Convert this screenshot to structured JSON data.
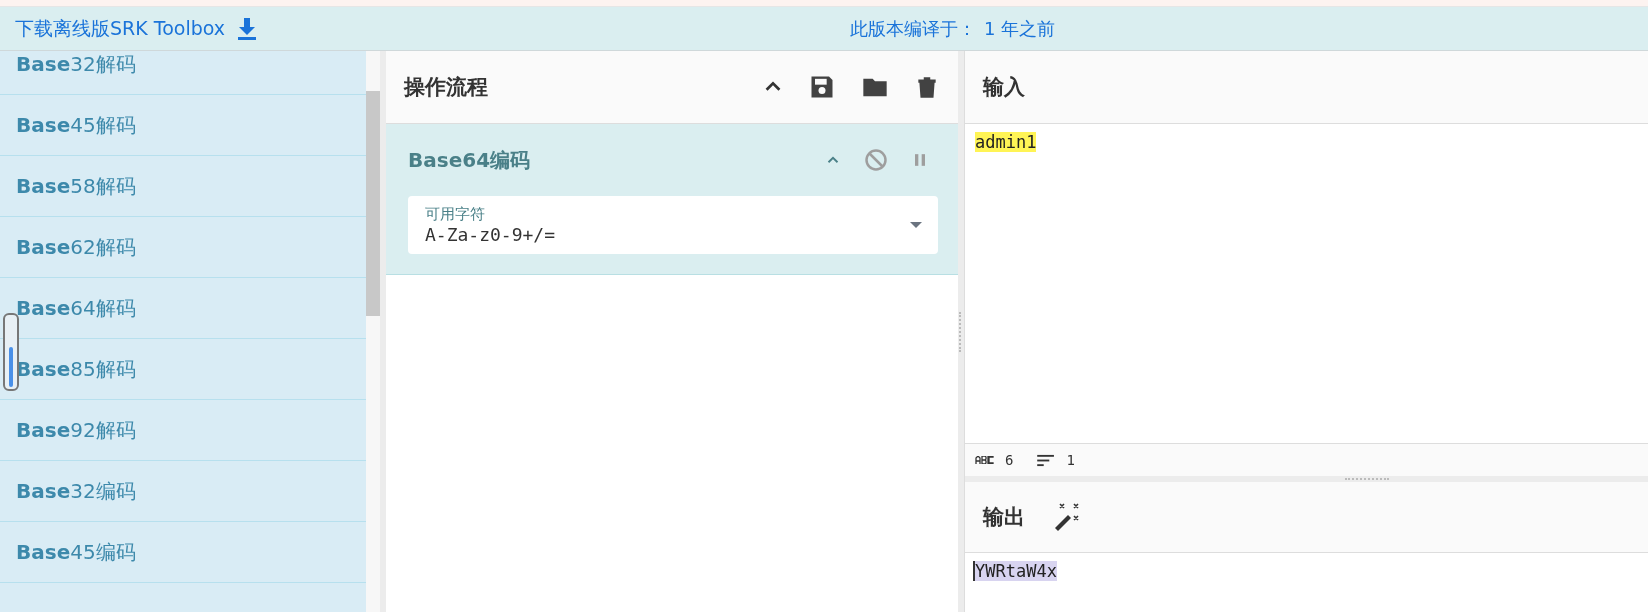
{
  "header": {
    "download_link": "下载离线版SRK Toolbox",
    "build_label": "此版本编译于：",
    "build_age": "1 年之前"
  },
  "sidebar": {
    "items": [
      {
        "label": "**Base**32解码"
      },
      {
        "label": "**Base**45解码"
      },
      {
        "label": "**Base**58解码"
      },
      {
        "label": "**Base**62解码"
      },
      {
        "label": "**Base**64解码"
      },
      {
        "label": "**Base**85解码"
      },
      {
        "label": "**Base**92解码"
      },
      {
        "label": "**Base**32编码"
      },
      {
        "label": "**Base**45编码"
      }
    ]
  },
  "recipe": {
    "title": "操作流程",
    "operations": [
      {
        "name": "Base64编码",
        "field": {
          "label": "可用字符",
          "value": "A-Za-z0-9+/="
        }
      }
    ]
  },
  "input": {
    "title": "输入",
    "text": "admin1",
    "status": {
      "length": "6",
      "lines": "1"
    }
  },
  "output": {
    "title": "输出",
    "text": "YWRtaW4x"
  }
}
